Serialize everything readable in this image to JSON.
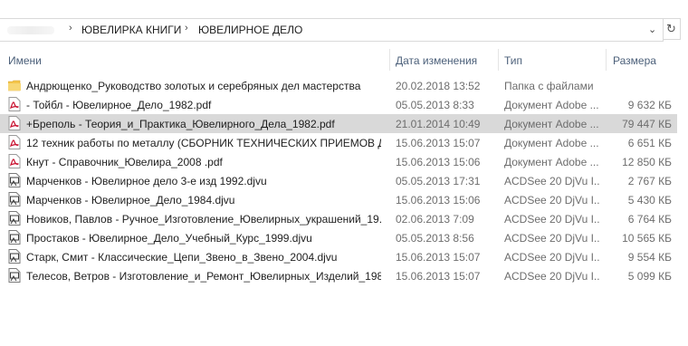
{
  "breadcrumb": {
    "items": [
      "ЮВЕЛИРКА КНИГИ",
      "ЮВЕЛИРНОЕ ДЕЛО"
    ],
    "separator": "›",
    "dropdown": "⌄",
    "refresh": "↻"
  },
  "columns": {
    "name": "Имени",
    "date": "Дата изменения",
    "type": "Тип",
    "size": "Размера"
  },
  "files": [
    {
      "name": "Андрющенко_Руководство золотых и серебряных дел мастерства",
      "date": "20.02.2018 13:52",
      "type": "Папка с файлами",
      "size": "",
      "icon": "folder-icon"
    },
    {
      "name": "- Тойбл - Ювелирное_Дело_1982.pdf",
      "date": "05.05.2013 8:33",
      "type": "Документ Adobe ...",
      "size": "9 632 КБ",
      "icon": "pdf-icon"
    },
    {
      "name": "+Бреполь - Теория_и_Практика_Ювелирного_Дела_1982.pdf",
      "date": "21.01.2014 10:49",
      "type": "Документ Adobe ...",
      "size": "79 447 КБ",
      "icon": "pdf-icon"
    },
    {
      "name": "12 техник работы по металлу (СБОРНИК ТЕХНИЧЕСКИХ ПРИЕМОВ Д...",
      "date": "15.06.2013 15:07",
      "type": "Документ Adobe ...",
      "size": "6 651 КБ",
      "icon": "pdf-icon"
    },
    {
      "name": "Кнут - Справочник_Ювелира_2008 .pdf",
      "date": "15.06.2013 15:06",
      "type": "Документ Adobe ...",
      "size": "12 850 КБ",
      "icon": "pdf-icon"
    },
    {
      "name": "Марченков - Ювелирное дело 3-е изд 1992.djvu",
      "date": "05.05.2013 17:31",
      "type": "ACDSee 20 DjVu I...",
      "size": "2 767 КБ",
      "icon": "djvu-icon"
    },
    {
      "name": "Марченков - Ювелирное_Дело_1984.djvu",
      "date": "15.06.2013 15:06",
      "type": "ACDSee 20 DjVu I...",
      "size": "5 430 КБ",
      "icon": "djvu-icon"
    },
    {
      "name": "Новиков, Павлов - Ручное_Изготовление_Ювелирных_украшений_19...",
      "date": "02.06.2013 7:09",
      "type": "ACDSee 20 DjVu I...",
      "size": "6 764 КБ",
      "icon": "djvu-icon"
    },
    {
      "name": "Простаков - Ювелирное_Дело_Учебный_Курс_1999.djvu",
      "date": "05.05.2013 8:56",
      "type": "ACDSee 20 DjVu I...",
      "size": "10 565 КБ",
      "icon": "djvu-icon"
    },
    {
      "name": "Старк, Смит - Классические_Цепи_Звено_в_Звено_2004.djvu",
      "date": "15.06.2013 15:07",
      "type": "ACDSee 20 DjVu I...",
      "size": "9 554 КБ",
      "icon": "djvu-icon"
    },
    {
      "name": "Телесов, Ветров - Изготовление_и_Ремонт_Ювелирных_Изделий_198...",
      "date": "15.06.2013 15:07",
      "type": "ACDSee 20 DjVu I...",
      "size": "5 099 КБ",
      "icon": "djvu-icon"
    }
  ],
  "selected_index": 2,
  "colors": {
    "header_text": "#4c607a",
    "selection": "#d9d9d9",
    "pdf_red": "#c8102e",
    "folder_yellow": "#f3c54a"
  }
}
